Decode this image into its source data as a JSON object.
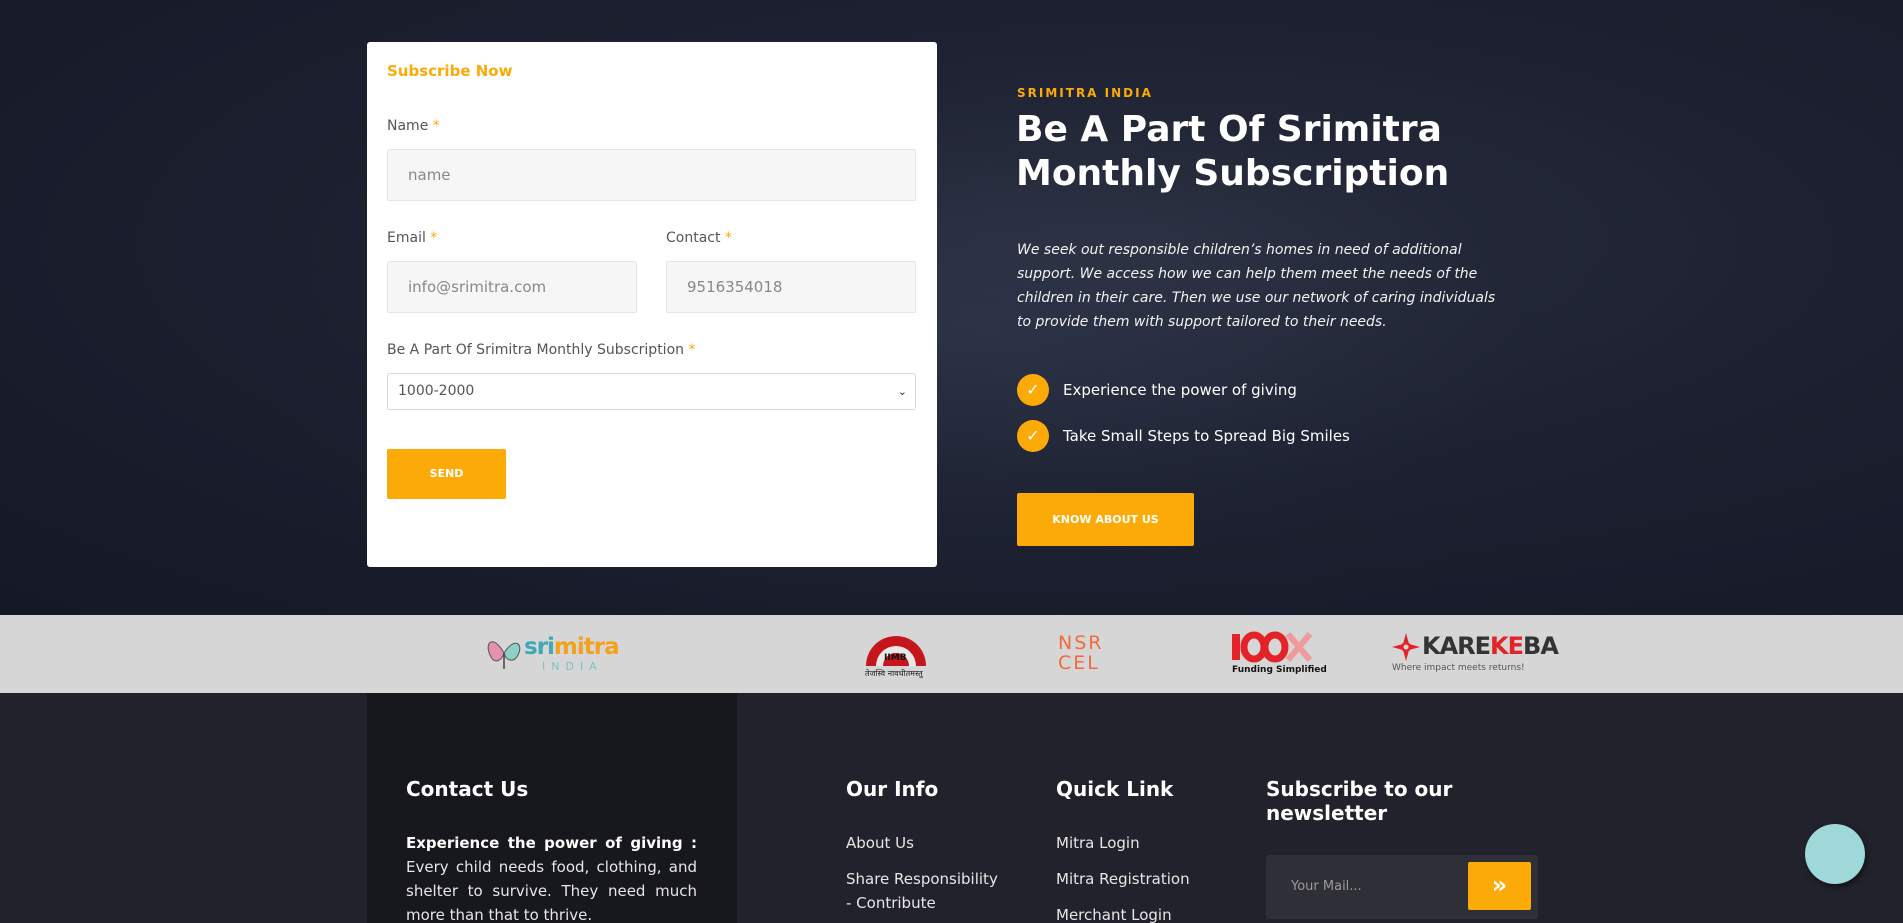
{
  "form": {
    "title": "Subscribe Now",
    "name_label": "Name",
    "name_placeholder": "name",
    "email_label": "Email",
    "email_placeholder": "info@srimitra.com",
    "contact_label": "Contact",
    "contact_placeholder": "9516354018",
    "subscription_label": "Be A Part Of Srimitra Monthly Subscription",
    "subscription_value": "1000-2000",
    "required_mark": "*",
    "send_label": "SEND"
  },
  "about": {
    "eyebrow": "SRIMITRA INDIA",
    "headline": "Be A Part Of Srimitra Monthly Subscription",
    "description": "We seek out responsible children’s homes in need of additional support. We access how we can help them meet the needs of the children in their care. Then we use our network of caring individuals to provide them with support tailored to their needs.",
    "points": [
      "Experience the power of giving",
      "Take Small Steps to Spread Big Smiles"
    ],
    "cta": "KNOW ABOUT US"
  },
  "partners": {
    "srimitra": {
      "sri": "sri",
      "mitra": "mitra",
      "india": "INDIA"
    },
    "iimb": {
      "name": "IIMB",
      "motto": "तेजस्वि नावधीतमस्तु"
    },
    "nsrcel": {
      "line1": "NSR",
      "line2": "CEL"
    },
    "x100": {
      "tagline": "Funding Simplified"
    },
    "karekeba": {
      "kare": "KARE",
      "ke": "KE",
      "ba": "BA",
      "tagline": "Where impact meets returns!"
    }
  },
  "footer": {
    "contact": {
      "heading": "Contact Us",
      "lead": "Experience the power of giving :",
      "text": " Every child needs food, clothing, and shelter to survive. They need much more than that to thrive."
    },
    "our_info": {
      "heading": "Our Info",
      "links": [
        "About Us",
        "Share Responsibility",
        "- Contribute"
      ]
    },
    "quick_link": {
      "heading": "Quick Link",
      "links": [
        "Mitra Login",
        "Mitra Registration",
        "Merchant Login"
      ]
    },
    "newsletter": {
      "heading": "Subscribe to our newsletter",
      "placeholder": "Your Mail...",
      "button_icon": "double-chevron-right-icon"
    }
  },
  "colors": {
    "accent": "#fcaa07",
    "hero_bg": "#1c2030",
    "footer_bg": "#22222c",
    "contact_panel": "#17171e",
    "partners_bg": "#d6d6d6"
  }
}
